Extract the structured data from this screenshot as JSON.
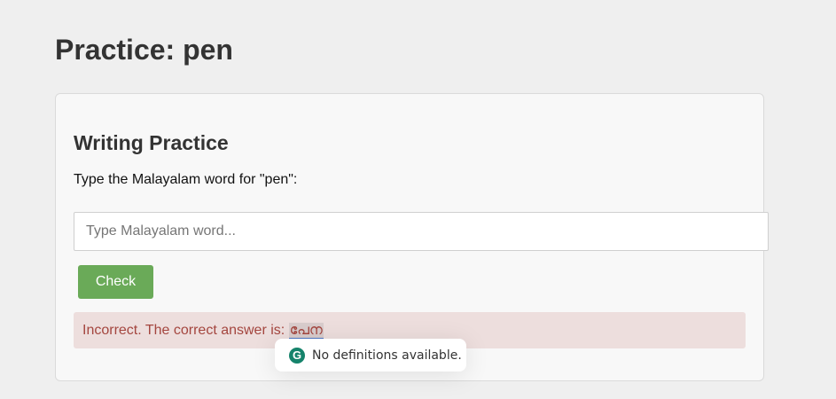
{
  "page": {
    "title": "Practice: pen"
  },
  "practice": {
    "heading": "Writing Practice",
    "prompt": "Type the Malayalam word for \"pen\":",
    "input_value": "",
    "input_placeholder": "Type Malayalam word...",
    "check_label": "Check"
  },
  "feedback": {
    "message": "Incorrect. The correct answer is: ",
    "answer": "പേന"
  },
  "tooltip": {
    "icon": "grammarly-icon",
    "icon_letter": "G",
    "text": "No definitions available."
  },
  "colors": {
    "background": "#efefef",
    "card": "#f8f8f8",
    "button": "#6aaa58",
    "feedback_bg": "#eddedd",
    "feedback_text": "#a4463f",
    "tooltip_icon": "#15836b"
  }
}
